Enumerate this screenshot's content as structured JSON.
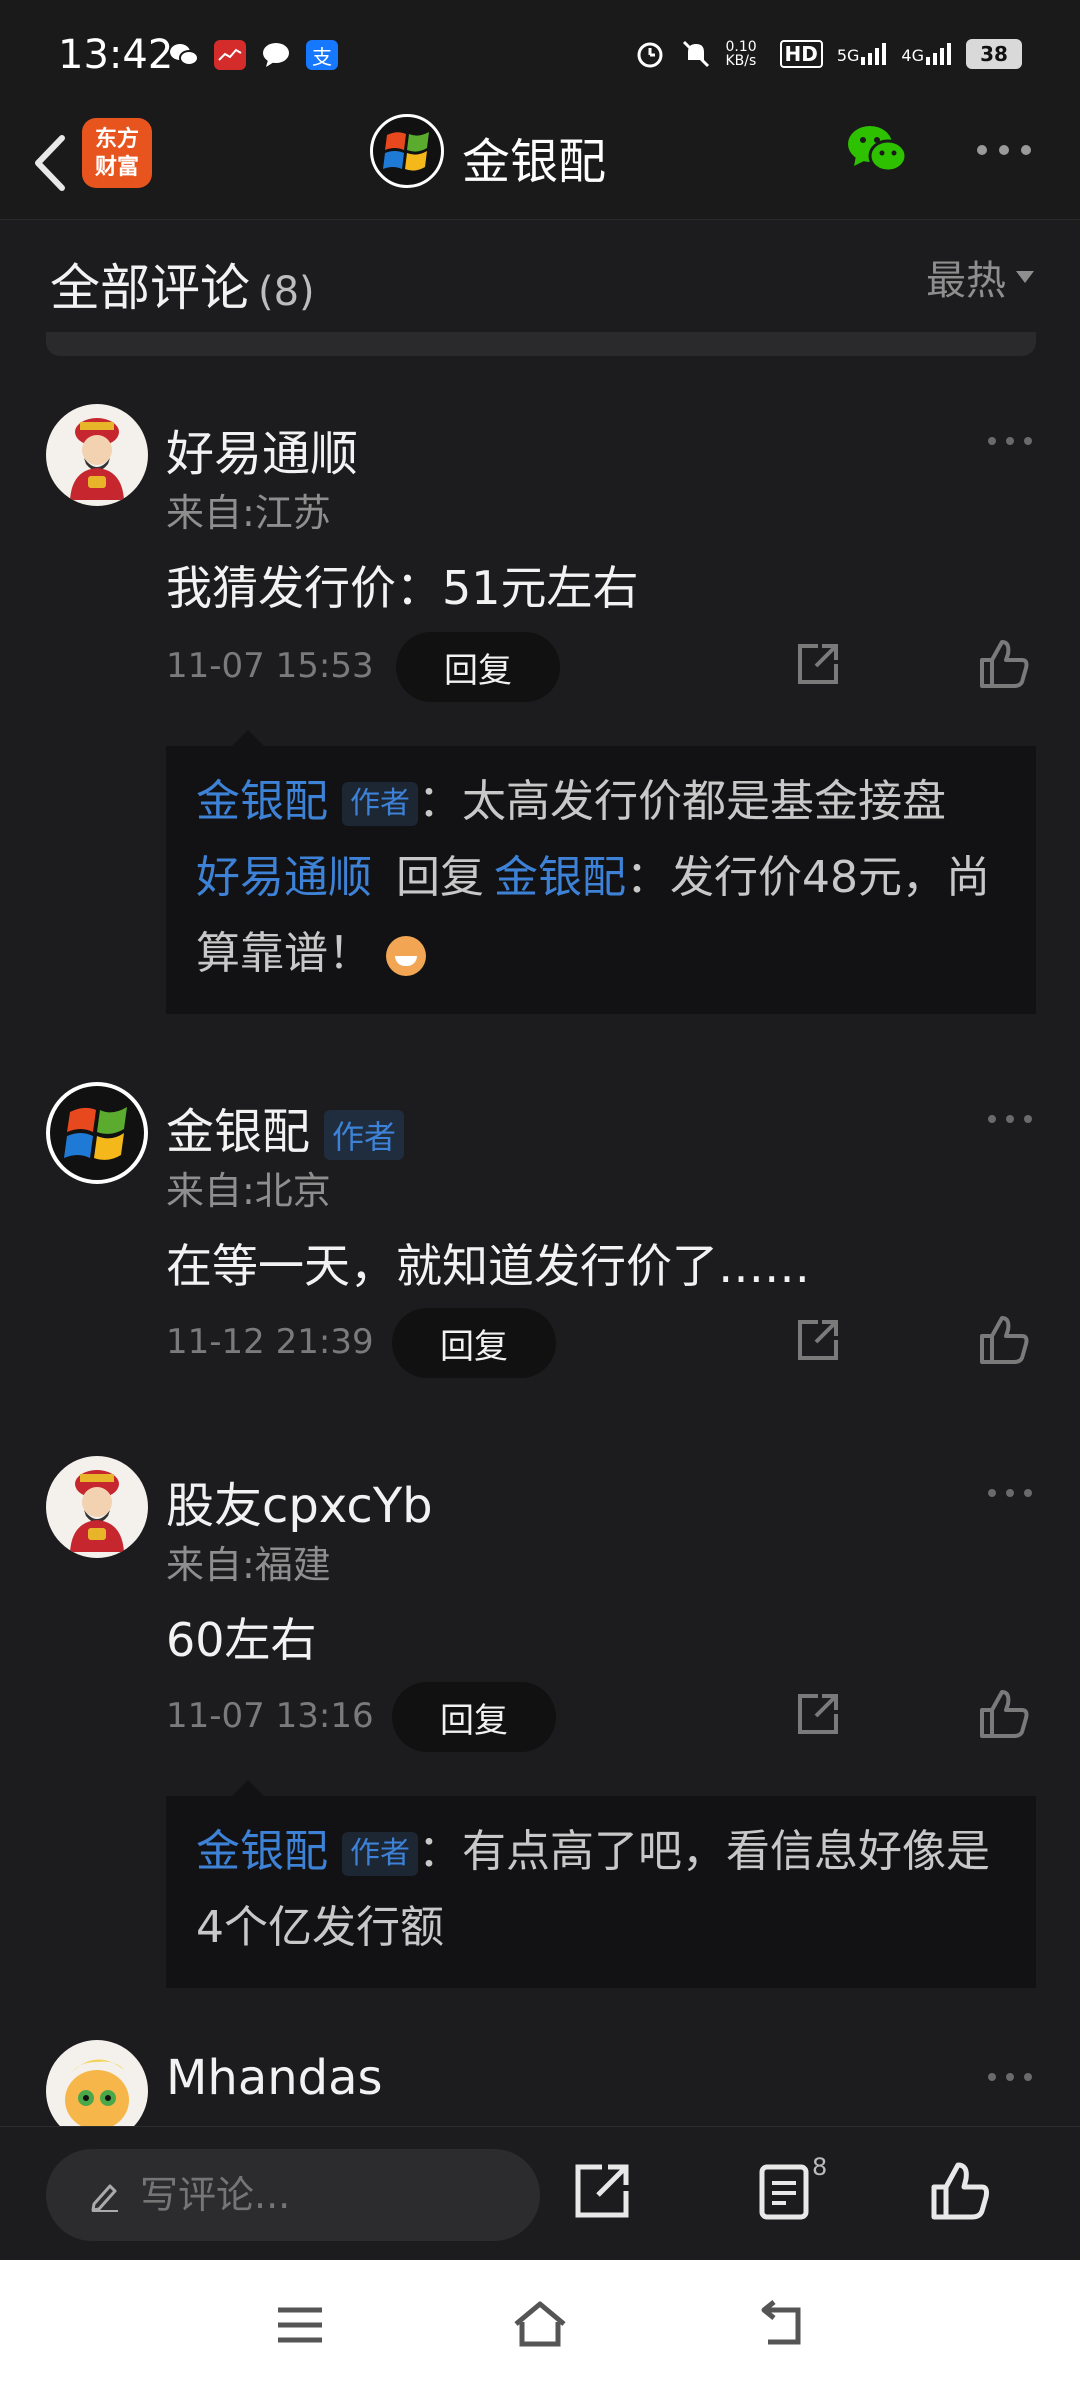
{
  "status_bar": {
    "time": "13:42",
    "net_speed": "0.10 KB/s",
    "hd": "HD",
    "net1": "5G",
    "net2": "4G",
    "battery": "38"
  },
  "header": {
    "brand_logo_text": "东方财富",
    "channel_name": "金银配"
  },
  "comments_section": {
    "title": "全部评论",
    "count": "(8)",
    "sort_label": "最热"
  },
  "comments": [
    {
      "user": "好易通顺",
      "from": "来自:江苏",
      "text": "我猜发行价：51元左右",
      "time": "11-07 15:53",
      "reply_label": "回复",
      "replies": [
        {
          "user": "金银配",
          "badge": "作者",
          "sep": "：",
          "text": "太高发行价都是基金接盘"
        },
        {
          "user": "好易通顺",
          "mid": "回复",
          "target": "金银配",
          "sep": "：",
          "text": "发行价48元，尚算靠谱！"
        }
      ]
    },
    {
      "user": "金银配",
      "badge": "作者",
      "from": "来自:北京",
      "text": "在等一天，就知道发行价了……",
      "time": "11-12 21:39",
      "reply_label": "回复"
    },
    {
      "user": "股友cpxcYb",
      "from": "来自:福建",
      "text": "60左右",
      "time": "11-07 13:16",
      "reply_label": "回复",
      "replies": [
        {
          "user": "金银配",
          "badge": "作者",
          "sep": "：",
          "text": "有点高了吧，看信息好像是4个亿发行额"
        }
      ]
    },
    {
      "user": "Mhandas"
    }
  ],
  "toolbar": {
    "write_placeholder": "写评论...",
    "comment_count": "8"
  }
}
